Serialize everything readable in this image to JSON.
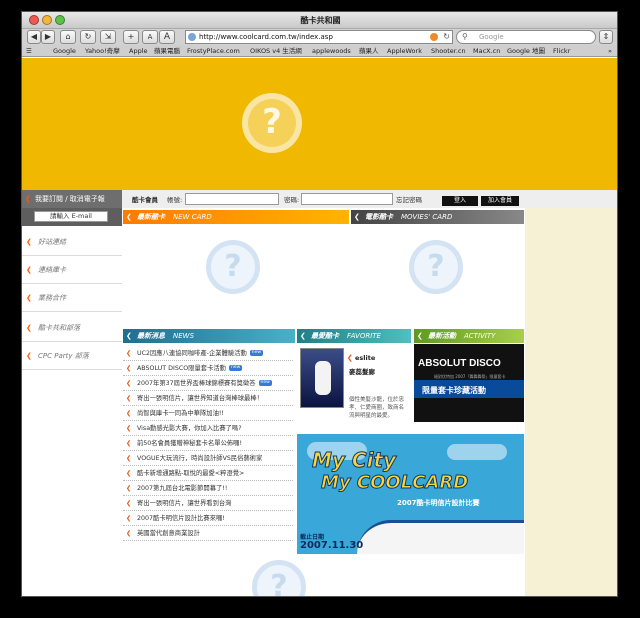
{
  "window": {
    "title": "酷卡共和國"
  },
  "toolbar": {
    "url": "http://www.coolcard.com.tw/index.asp",
    "search_placeholder": "Google",
    "font_small": "A",
    "font_large": "A",
    "add": "+"
  },
  "bookmarks": [
    "Google",
    "Yahoo!奇摩",
    "Apple",
    "蘋果電腦",
    "FrostyPlace.com",
    "OIKOS v4 生活網",
    "applewoods",
    "蘋果人",
    "AppleWork",
    "Shooter.cn",
    "MacX.cn",
    "Google 地圖",
    "Flickr"
  ],
  "login": {
    "subscribe": "我要訂閱 / 取消電子報",
    "member_label": "酷卡會員",
    "account_label": "帳號:",
    "password_label": "密碼:",
    "forgot": "忘記密碼",
    "login_btn": "登入",
    "join_btn": "加入會員"
  },
  "left": {
    "email_placeholder": "請輸入 E-mail",
    "nav": [
      "好站連結",
      "連絡庫卡",
      "業務合作",
      "酷卡共和部落",
      "CPC Party 部落"
    ]
  },
  "sections": {
    "new_card": {
      "cn": "最新酷卡",
      "en": "NEW CARD"
    },
    "e_card": {
      "cn": "電影酷卡",
      "en": "MOVIES' CARD"
    },
    "news": {
      "cn": "最新消息",
      "en": "NEWS"
    },
    "favorite": {
      "cn": "最愛酷卡",
      "en": "FAVORITE"
    },
    "activity": {
      "cn": "最新活動",
      "en": "ACTIVITY"
    }
  },
  "news": [
    {
      "text": "UC2因應八連協同咖啡產-企業體驗活動",
      "new": true
    },
    {
      "text": "ABSOLUT DISCO限量套卡活動",
      "new": true
    },
    {
      "text": "2007年第37屆世界盃棒球錦標賽有獎徵答",
      "new": true
    },
    {
      "text": "寄出一張明信片，讓世界知道台灣棒球最棒！",
      "new": false
    },
    {
      "text": "尚智與庫卡一同為中華隊加油!!",
      "new": false
    },
    {
      "text": "Visa動感光影大賽，你加入比賽了嗎?",
      "new": false
    },
    {
      "text": "前50名會員獲贈神秘套卡名單公佈囉!",
      "new": false
    },
    {
      "text": "VOGUE大玩流行，時尚設計師VS民俗藝術家",
      "new": false
    },
    {
      "text": "酷卡新增通路點-取悅的最愛<粹澄覺>",
      "new": false
    },
    {
      "text": "2007第九屆台北電影節開幕了!!",
      "new": false
    },
    {
      "text": "寄出一張明信片，讓世界看到台灣",
      "new": false
    },
    {
      "text": "2007酷卡明信片設計比賽來囉!",
      "new": false
    },
    {
      "text": "英國當代創意商業設計",
      "new": false
    }
  ],
  "favorite": {
    "brand": "eslite",
    "title": "麥蕊髮廊",
    "desc": "個性美髮沙龍，位於忠孝、仁愛商圈，致商名流與明星的最愛。"
  },
  "activity": {
    "brand": "ABSOLUT DISCO",
    "sub": "絕對伏特加 2007「舞舞舞祭」限量套卡",
    "cn": "限量套卡珍藏活動"
  },
  "city": {
    "line1": "My City",
    "line2": "My COOLCARD",
    "sub": "2007酷卡明信片設計比賽",
    "date_label": "截止日期",
    "date": "2007.11.30"
  },
  "colors": {
    "banner": "#f1b800",
    "orange_head": "#ff8a00",
    "dark_head": "#555555",
    "news_head": "#2f8fb0",
    "fav_head": "#2e9c9c",
    "act_head": "#7ab03a"
  }
}
